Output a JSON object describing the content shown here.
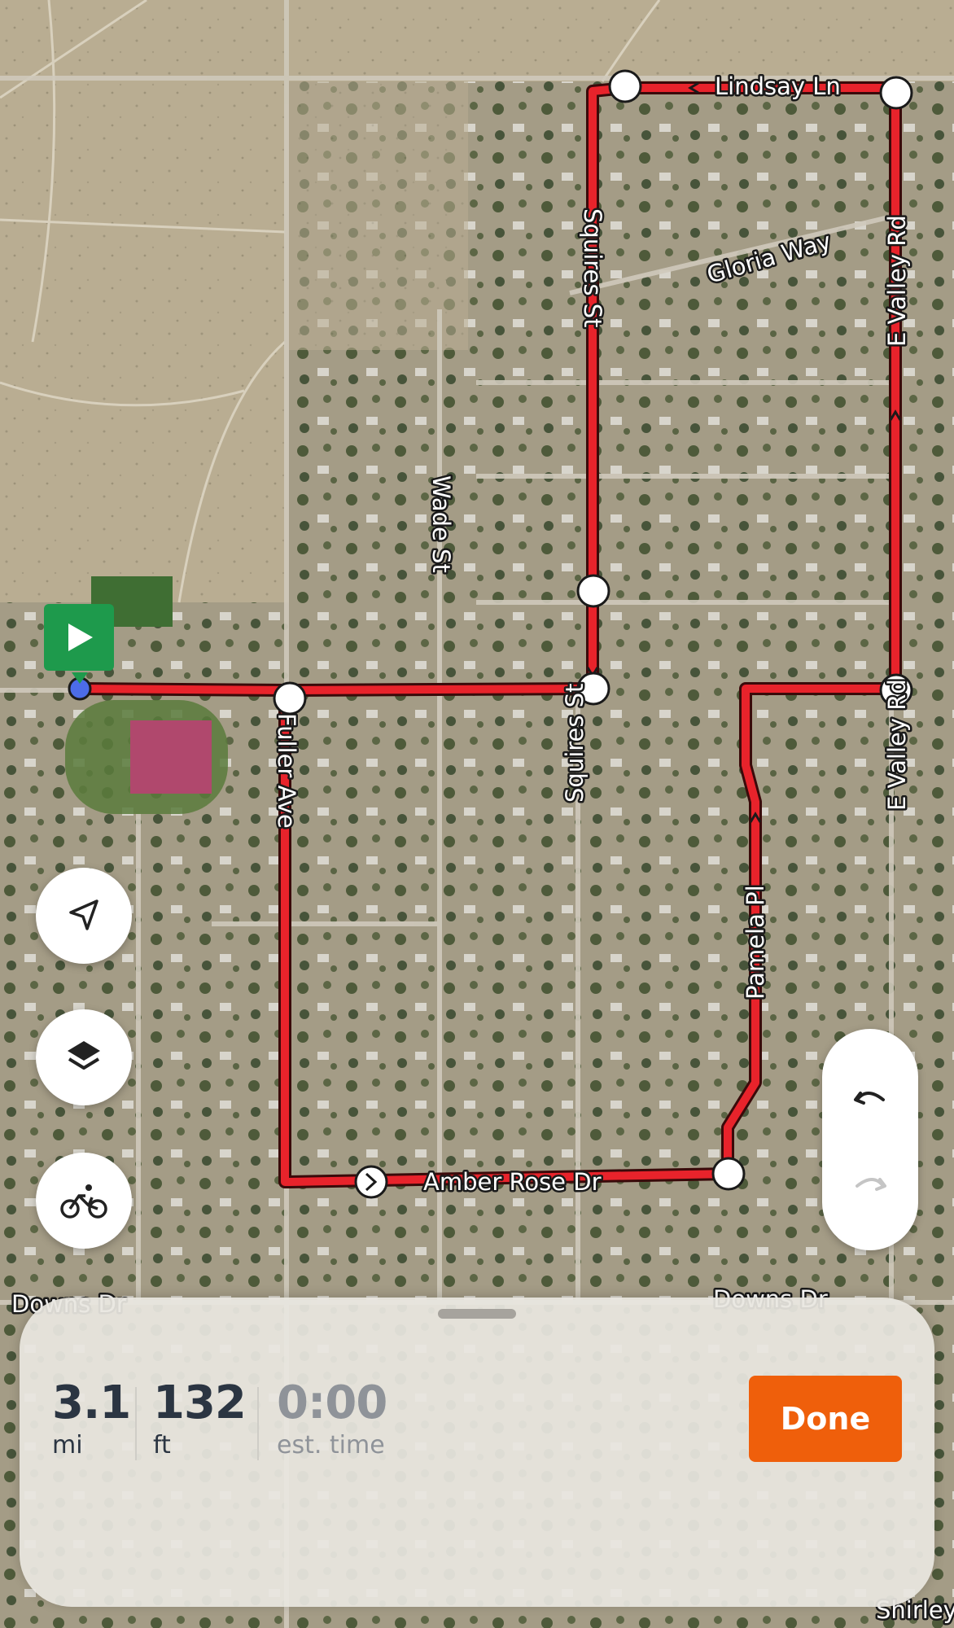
{
  "map": {
    "street_labels": {
      "lindsay": "Lindsay Ln",
      "gloria": "Gloria Way",
      "evalley_top": "E Valley Rd",
      "evalley_bottom": "E Valley Rd",
      "squires_top": "Squires St",
      "squires_bottom": "Squires St",
      "wade": "Wade St",
      "fuller": "Fuller Ave",
      "pamela": "Pamela Pl",
      "amber": "Amber Rose Dr",
      "downs_left": "Downs Dr",
      "downs_right": "Downs Dr",
      "shirley": "Shirley"
    },
    "route_color": "#e8232b",
    "start_marker_color": "#1e9a4c"
  },
  "controls": {
    "locate_icon": "navigation-arrow-icon",
    "layers_icon": "layers-icon",
    "activity_icon": "bicycle-icon",
    "undo_icon": "undo-icon",
    "redo_icon": "redo-icon"
  },
  "summary": {
    "distance_value": "3.1",
    "distance_unit": "mi",
    "elevation_value": "132",
    "elevation_unit": "ft",
    "time_value": "0:00",
    "time_unit": "est. time",
    "done_label": "Done"
  },
  "colors": {
    "accent": "#ef5f0b",
    "text": "#2b3542",
    "muted": "#8f9399"
  }
}
